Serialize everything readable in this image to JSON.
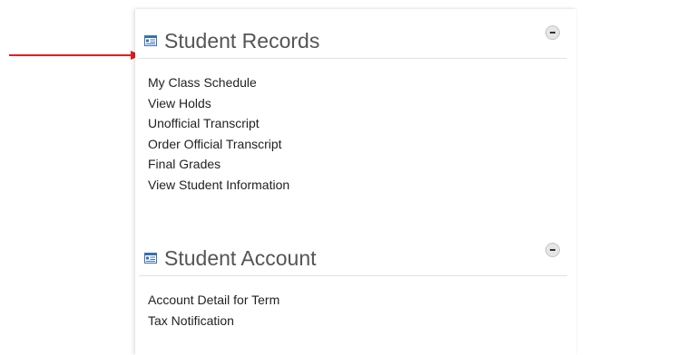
{
  "sections": [
    {
      "title": "Student Records",
      "icon": "id-card-icon",
      "collapse_icon": "minus-circle-icon",
      "links": [
        "My Class Schedule",
        "View Holds",
        "Unofficial Transcript",
        "Order Official Transcript",
        "Final Grades",
        "View Student Information"
      ]
    },
    {
      "title": "Student Account",
      "icon": "id-card-icon",
      "collapse_icon": "minus-circle-icon",
      "links": [
        "Account Detail for Term",
        "Tax Notification"
      ]
    }
  ],
  "annotation": {
    "arrow_color": "#e02020",
    "icon_color": "#3a6fb0"
  }
}
